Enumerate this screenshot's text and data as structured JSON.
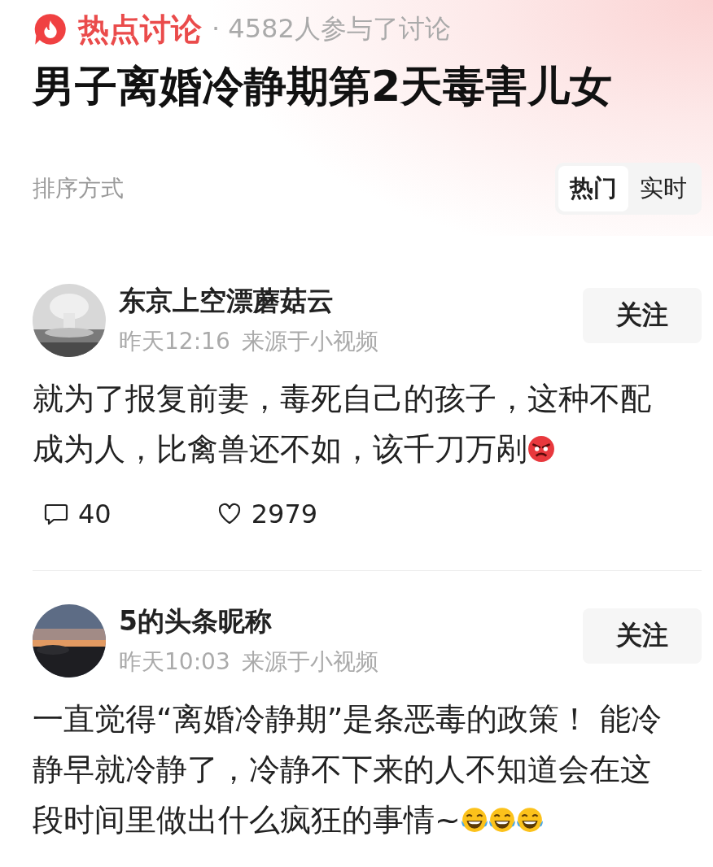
{
  "header": {
    "brand": "热点讨论",
    "participants": "· 4582人参与了讨论",
    "title": "男子离婚冷静期第2天毒害儿女"
  },
  "sort": {
    "label": "排序方式",
    "tabs": [
      {
        "label": "热门",
        "selected": true
      },
      {
        "label": "实时",
        "selected": false
      }
    ]
  },
  "comments": [
    {
      "author": "东京上空漂蘑菇云",
      "time": "昨天12:16",
      "source": "来源于小视频",
      "follow": "关注",
      "lines": [
        "就为了报复前妻，毒死自己的孩子，这种不配",
        "成为人，比禽兽还不如，该千刀万剐"
      ],
      "emojis": [
        {
          "kind": "angry"
        }
      ],
      "replies": "40",
      "likes": "2979"
    },
    {
      "author": "5的头条昵称",
      "time": "昨天10:03",
      "source": "来源于小视频",
      "follow": "关注",
      "lines": [
        "一直觉得“离婚冷静期”是条恶毒的政策！ 能冷",
        "静早就冷静了，冷静不下来的人不知道会在这",
        "段时间里做出什么疯狂的事情~"
      ],
      "emojis": [
        {
          "kind": "laughing"
        },
        {
          "kind": "laughing"
        },
        {
          "kind": "laughing"
        }
      ]
    }
  ]
}
